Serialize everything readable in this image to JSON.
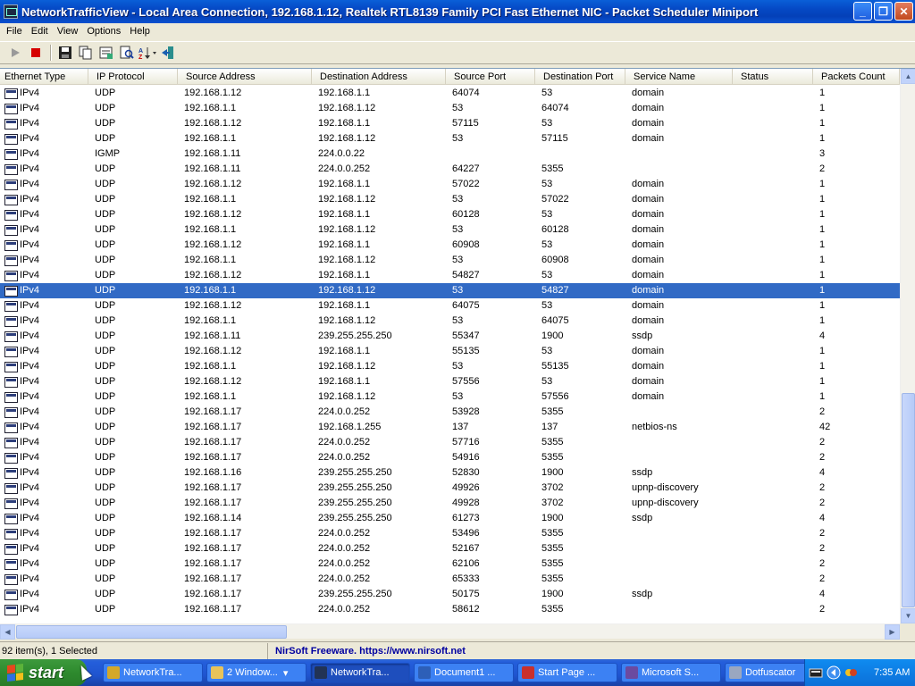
{
  "window": {
    "title": "NetworkTrafficView  -  Local Area Connection, 192.168.1.12, Realtek RTL8139 Family PCI Fast Ethernet NIC - Packet Scheduler Miniport",
    "minimize": "_",
    "maximize": "❐",
    "close": "✕"
  },
  "menu": [
    "File",
    "Edit",
    "View",
    "Options",
    "Help"
  ],
  "toolbar": {
    "icons": [
      "play-icon",
      "stop-icon",
      "save-icon",
      "copy-icon",
      "properties-icon",
      "find-icon",
      "sort-icon",
      "exit-icon"
    ]
  },
  "columns": [
    "Ethernet Type",
    "IP Protocol",
    "Source Address",
    "Destination Address",
    "Source Port",
    "Destination Port",
    "Service Name",
    "Status",
    "Packets Count"
  ],
  "rows": [
    [
      "IPv4",
      "UDP",
      "192.168.1.12",
      "192.168.1.1",
      "64074",
      "53",
      "domain",
      "",
      "1"
    ],
    [
      "IPv4",
      "UDP",
      "192.168.1.1",
      "192.168.1.12",
      "53",
      "64074",
      "domain",
      "",
      "1"
    ],
    [
      "IPv4",
      "UDP",
      "192.168.1.12",
      "192.168.1.1",
      "57115",
      "53",
      "domain",
      "",
      "1"
    ],
    [
      "IPv4",
      "UDP",
      "192.168.1.1",
      "192.168.1.12",
      "53",
      "57115",
      "domain",
      "",
      "1"
    ],
    [
      "IPv4",
      "IGMP",
      "192.168.1.11",
      "224.0.0.22",
      "",
      "",
      "",
      "",
      "3"
    ],
    [
      "IPv4",
      "UDP",
      "192.168.1.11",
      "224.0.0.252",
      "64227",
      "5355",
      "",
      "",
      "2"
    ],
    [
      "IPv4",
      "UDP",
      "192.168.1.12",
      "192.168.1.1",
      "57022",
      "53",
      "domain",
      "",
      "1"
    ],
    [
      "IPv4",
      "UDP",
      "192.168.1.1",
      "192.168.1.12",
      "53",
      "57022",
      "domain",
      "",
      "1"
    ],
    [
      "IPv4",
      "UDP",
      "192.168.1.12",
      "192.168.1.1",
      "60128",
      "53",
      "domain",
      "",
      "1"
    ],
    [
      "IPv4",
      "UDP",
      "192.168.1.1",
      "192.168.1.12",
      "53",
      "60128",
      "domain",
      "",
      "1"
    ],
    [
      "IPv4",
      "UDP",
      "192.168.1.12",
      "192.168.1.1",
      "60908",
      "53",
      "domain",
      "",
      "1"
    ],
    [
      "IPv4",
      "UDP",
      "192.168.1.1",
      "192.168.1.12",
      "53",
      "60908",
      "domain",
      "",
      "1"
    ],
    [
      "IPv4",
      "UDP",
      "192.168.1.12",
      "192.168.1.1",
      "54827",
      "53",
      "domain",
      "",
      "1"
    ],
    [
      "IPv4",
      "UDP",
      "192.168.1.1",
      "192.168.1.12",
      "53",
      "54827",
      "domain",
      "",
      "1"
    ],
    [
      "IPv4",
      "UDP",
      "192.168.1.12",
      "192.168.1.1",
      "64075",
      "53",
      "domain",
      "",
      "1"
    ],
    [
      "IPv4",
      "UDP",
      "192.168.1.1",
      "192.168.1.12",
      "53",
      "64075",
      "domain",
      "",
      "1"
    ],
    [
      "IPv4",
      "UDP",
      "192.168.1.11",
      "239.255.255.250",
      "55347",
      "1900",
      "ssdp",
      "",
      "4"
    ],
    [
      "IPv4",
      "UDP",
      "192.168.1.12",
      "192.168.1.1",
      "55135",
      "53",
      "domain",
      "",
      "1"
    ],
    [
      "IPv4",
      "UDP",
      "192.168.1.1",
      "192.168.1.12",
      "53",
      "55135",
      "domain",
      "",
      "1"
    ],
    [
      "IPv4",
      "UDP",
      "192.168.1.12",
      "192.168.1.1",
      "57556",
      "53",
      "domain",
      "",
      "1"
    ],
    [
      "IPv4",
      "UDP",
      "192.168.1.1",
      "192.168.1.12",
      "53",
      "57556",
      "domain",
      "",
      "1"
    ],
    [
      "IPv4",
      "UDP",
      "192.168.1.17",
      "224.0.0.252",
      "53928",
      "5355",
      "",
      "",
      "2"
    ],
    [
      "IPv4",
      "UDP",
      "192.168.1.17",
      "192.168.1.255",
      "137",
      "137",
      "netbios-ns",
      "",
      "42"
    ],
    [
      "IPv4",
      "UDP",
      "192.168.1.17",
      "224.0.0.252",
      "57716",
      "5355",
      "",
      "",
      "2"
    ],
    [
      "IPv4",
      "UDP",
      "192.168.1.17",
      "224.0.0.252",
      "54916",
      "5355",
      "",
      "",
      "2"
    ],
    [
      "IPv4",
      "UDP",
      "192.168.1.16",
      "239.255.255.250",
      "52830",
      "1900",
      "ssdp",
      "",
      "4"
    ],
    [
      "IPv4",
      "UDP",
      "192.168.1.17",
      "239.255.255.250",
      "49926",
      "3702",
      "upnp-discovery",
      "",
      "2"
    ],
    [
      "IPv4",
      "UDP",
      "192.168.1.17",
      "239.255.255.250",
      "49928",
      "3702",
      "upnp-discovery",
      "",
      "2"
    ],
    [
      "IPv4",
      "UDP",
      "192.168.1.14",
      "239.255.255.250",
      "61273",
      "1900",
      "ssdp",
      "",
      "4"
    ],
    [
      "IPv4",
      "UDP",
      "192.168.1.17",
      "224.0.0.252",
      "53496",
      "5355",
      "",
      "",
      "2"
    ],
    [
      "IPv4",
      "UDP",
      "192.168.1.17",
      "224.0.0.252",
      "52167",
      "5355",
      "",
      "",
      "2"
    ],
    [
      "IPv4",
      "UDP",
      "192.168.1.17",
      "224.0.0.252",
      "62106",
      "5355",
      "",
      "",
      "2"
    ],
    [
      "IPv4",
      "UDP",
      "192.168.1.17",
      "224.0.0.252",
      "65333",
      "5355",
      "",
      "",
      "2"
    ],
    [
      "IPv4",
      "UDP",
      "192.168.1.17",
      "239.255.255.250",
      "50175",
      "1900",
      "ssdp",
      "",
      "4"
    ],
    [
      "IPv4",
      "UDP",
      "192.168.1.17",
      "224.0.0.252",
      "58612",
      "5355",
      "",
      "",
      "2"
    ]
  ],
  "selected_row": 13,
  "status": {
    "items": "92 item(s), 1 Selected",
    "credit": "NirSoft Freeware.  https://www.nirsoft.net"
  },
  "taskbar": {
    "start": "start",
    "tasks": [
      {
        "label": "NetworkTra...",
        "icon_color": "#d4a82a"
      },
      {
        "label": "2 Window...",
        "icon_color": "#e8c35a",
        "dropdown": "▾"
      },
      {
        "label": "NetworkTra...",
        "icon_color": "#223355",
        "active": true
      },
      {
        "label": "Document1 ...",
        "icon_color": "#2d5fb8"
      },
      {
        "label": "Start Page ...",
        "icon_color": "#c9302c"
      },
      {
        "label": "Microsoft S...",
        "icon_color": "#6b4aa0"
      },
      {
        "label": "Dotfuscator",
        "icon_color": "#9aa7c0"
      }
    ],
    "clock": "7:35 AM"
  },
  "colors": {
    "selection": "#316AC5",
    "title_bar": "#0548C4",
    "credit_text": "#0000A0"
  }
}
